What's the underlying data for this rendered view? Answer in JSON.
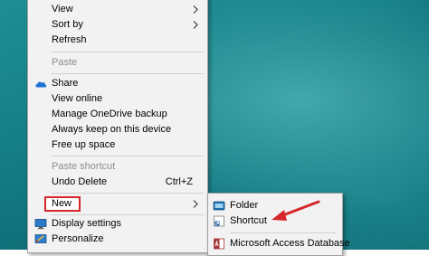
{
  "context_menu": {
    "items": [
      {
        "label": "View"
      },
      {
        "label": "Sort by"
      },
      {
        "label": "Refresh"
      },
      {
        "label": "Paste"
      },
      {
        "label": "Share"
      },
      {
        "label": "View online"
      },
      {
        "label": "Manage OneDrive backup"
      },
      {
        "label": "Always keep on this device"
      },
      {
        "label": "Free up space"
      },
      {
        "label": "Paste shortcut"
      },
      {
        "label": "Undo Delete",
        "shortcut": "Ctrl+Z"
      },
      {
        "label": "New"
      },
      {
        "label": "Display settings"
      },
      {
        "label": "Personalize"
      }
    ]
  },
  "new_submenu": {
    "items": [
      {
        "label": "Folder"
      },
      {
        "label": "Shortcut"
      },
      {
        "label": "Microsoft Access Database"
      }
    ]
  },
  "colors": {
    "highlight_outline": "#d6262b",
    "annotation_arrow": "#d6262b",
    "onedrive_blue": "#1e73d2"
  }
}
